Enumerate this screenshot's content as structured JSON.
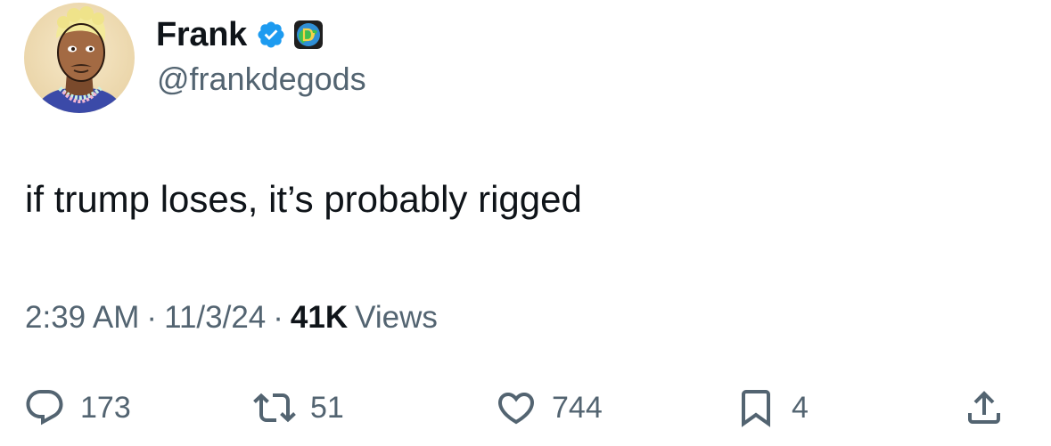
{
  "author": {
    "display_name": "Frank",
    "handle": "@frankdegods",
    "verified_icon": "verified-badge-icon",
    "affiliate_badge": "degods-affiliate-badge",
    "verified_color": "#1d9bf0"
  },
  "tweet": {
    "text": "if trump loses, it’s probably rigged",
    "time": "2:39 AM",
    "date": "11/3/24",
    "separator": "·",
    "views_count": "41K",
    "views_label": "Views"
  },
  "actions": {
    "reply": {
      "icon": "reply-icon",
      "count": "173"
    },
    "retweet": {
      "icon": "retweet-icon",
      "count": "51"
    },
    "like": {
      "icon": "heart-icon",
      "count": "744"
    },
    "bookmark": {
      "icon": "bookmark-icon",
      "count": "4"
    },
    "share": {
      "icon": "share-icon"
    }
  },
  "colors": {
    "text_primary": "#0f1419",
    "text_secondary": "#536471",
    "background": "#ffffff"
  }
}
